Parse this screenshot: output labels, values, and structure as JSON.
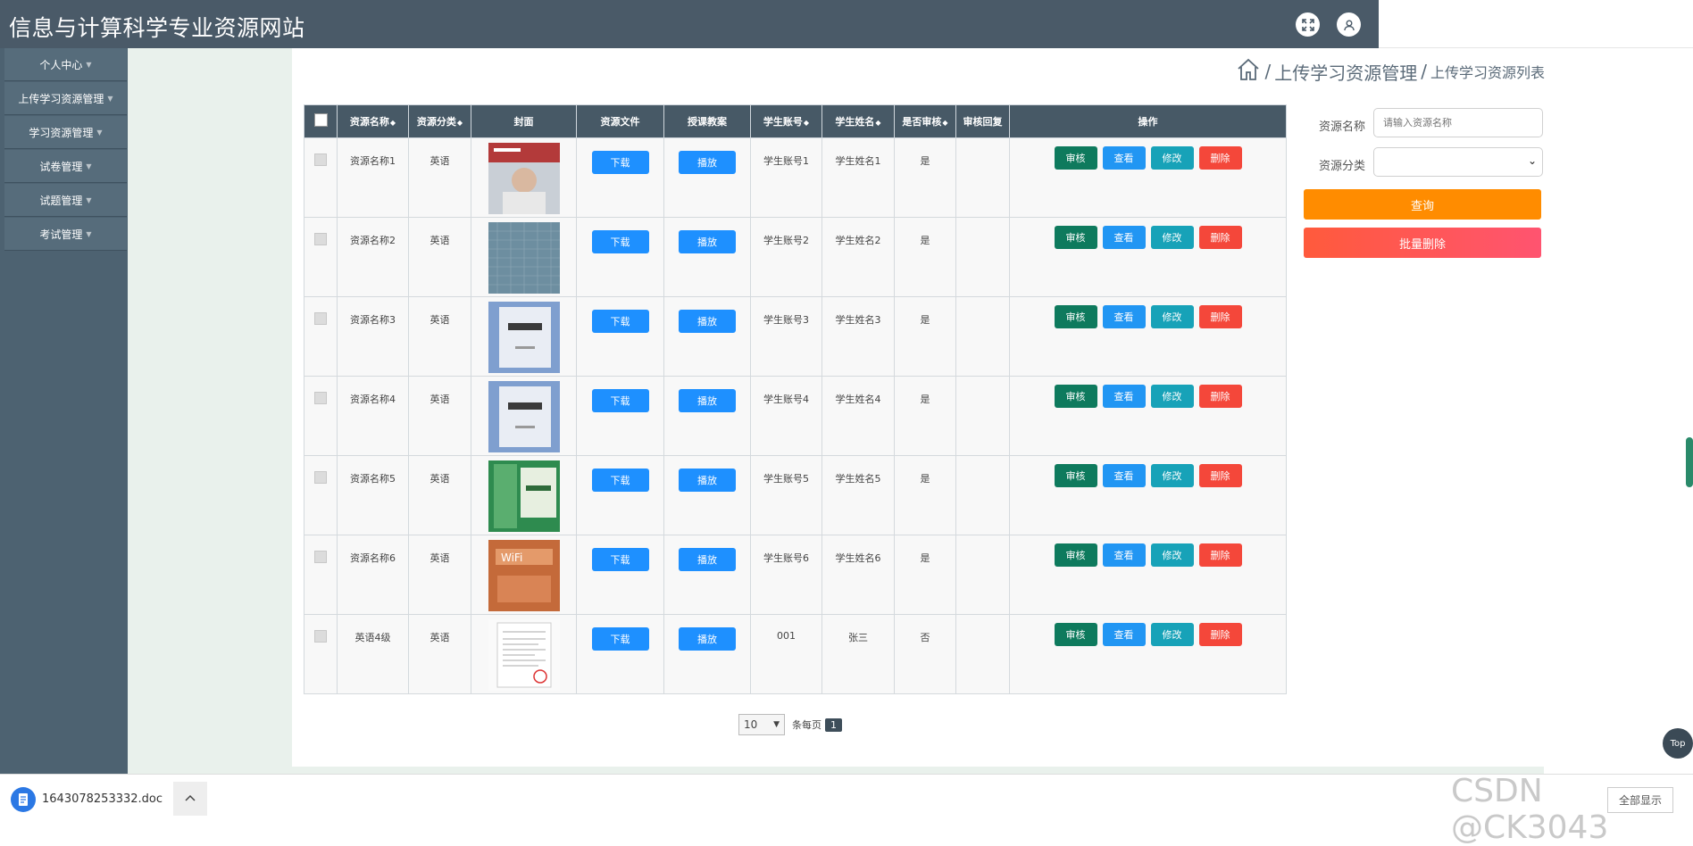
{
  "header": {
    "title": "信息与计算科学专业资源网站",
    "icons": [
      "fullscreen-icon",
      "user-icon"
    ]
  },
  "sidebar": {
    "items": [
      {
        "label": "个人中心"
      },
      {
        "label": "上传学习资源管理"
      },
      {
        "label": "学习资源管理"
      },
      {
        "label": "试卷管理"
      },
      {
        "label": "试题管理"
      },
      {
        "label": "考试管理"
      }
    ]
  },
  "breadcrumb": {
    "level1": "上传学习资源管理",
    "level2": "上传学习资源列表",
    "separator": "/"
  },
  "table": {
    "headers": {
      "name": "资源名称",
      "category": "资源分类",
      "cover": "封面",
      "file": "资源文件",
      "lesson": "授课教案",
      "account": "学生账号",
      "student": "学生姓名",
      "reviewed": "是否审核",
      "reply": "审核回复",
      "actions": "操作"
    },
    "rows": [
      {
        "name": "资源名称1",
        "category": "英语",
        "download": "下载",
        "play": "播放",
        "account": "学生账号1",
        "student": "学生姓名1",
        "reviewed": "是",
        "reply": "",
        "review": "审核",
        "view": "查看",
        "edit": "修改",
        "del": "删除"
      },
      {
        "name": "资源名称2",
        "category": "英语",
        "download": "下载",
        "play": "播放",
        "account": "学生账号2",
        "student": "学生姓名2",
        "reviewed": "是",
        "reply": "",
        "review": "审核",
        "view": "查看",
        "edit": "修改",
        "del": "删除"
      },
      {
        "name": "资源名称3",
        "category": "英语",
        "download": "下载",
        "play": "播放",
        "account": "学生账号3",
        "student": "学生姓名3",
        "reviewed": "是",
        "reply": "",
        "review": "审核",
        "view": "查看",
        "edit": "修改",
        "del": "删除"
      },
      {
        "name": "资源名称4",
        "category": "英语",
        "download": "下载",
        "play": "播放",
        "account": "学生账号4",
        "student": "学生姓名4",
        "reviewed": "是",
        "reply": "",
        "review": "审核",
        "view": "查看",
        "edit": "修改",
        "del": "删除"
      },
      {
        "name": "资源名称5",
        "category": "英语",
        "download": "下载",
        "play": "播放",
        "account": "学生账号5",
        "student": "学生姓名5",
        "reviewed": "是",
        "reply": "",
        "review": "审核",
        "view": "查看",
        "edit": "修改",
        "del": "删除"
      },
      {
        "name": "资源名称6",
        "category": "英语",
        "download": "下载",
        "play": "播放",
        "account": "学生账号6",
        "student": "学生姓名6",
        "reviewed": "是",
        "reply": "",
        "review": "审核",
        "view": "查看",
        "edit": "修改",
        "del": "删除"
      },
      {
        "name": "英语4级",
        "category": "英语",
        "download": "下载",
        "play": "播放",
        "account": "001",
        "student": "张三",
        "reviewed": "否",
        "reply": "",
        "review": "审核",
        "view": "查看",
        "edit": "修改",
        "del": "删除"
      }
    ]
  },
  "search": {
    "name_label": "资源名称",
    "name_placeholder": "请输入资源名称",
    "category_label": "资源分类",
    "category_value": "",
    "query_button": "查询",
    "batch_delete_button": "批量删除"
  },
  "pagination": {
    "page_size": "10",
    "per_page_label": "条每页",
    "current_page": "1"
  },
  "downloads": {
    "file_name": "1643078253332.doc",
    "show_all": "全部显示"
  },
  "watermark": "CSDN @CK3043",
  "top_button": "Top",
  "colors": {
    "header": "#4a5a68",
    "sidebar": "#4d6271",
    "primary_blue": "#1e90ff",
    "review_green": "#0e7a5d",
    "edit_teal": "#17a2b8",
    "delete_red": "#f4473a",
    "query_orange": "#ff8c00",
    "batch_delete": "#ff5a4e"
  }
}
